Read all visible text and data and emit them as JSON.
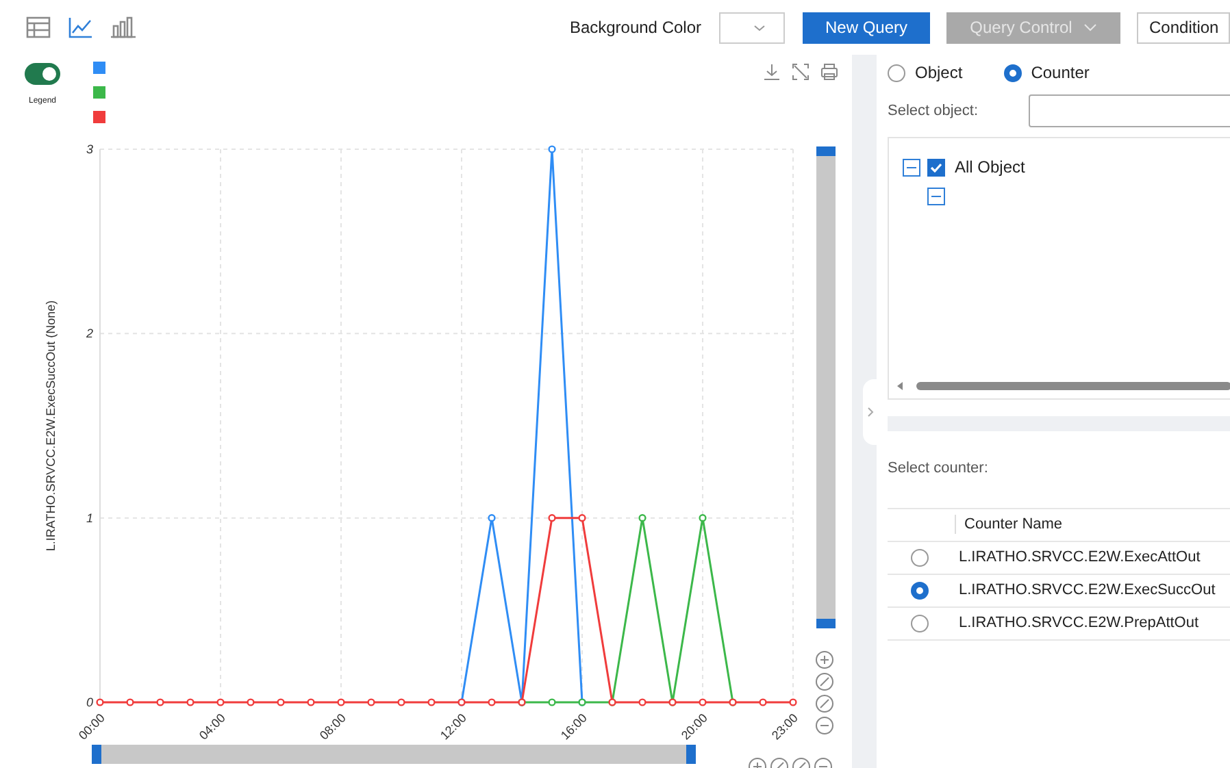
{
  "toolbar": {
    "views": [
      {
        "kind": "table",
        "selected": false
      },
      {
        "kind": "line",
        "selected": true
      },
      {
        "kind": "bar",
        "selected": false
      }
    ],
    "background_color_label": "Background Color",
    "buttons": [
      {
        "kind": "primary",
        "label": "New Query",
        "disabled": false
      },
      {
        "kind": "dropdown",
        "label": "Query Control",
        "disabled": true
      },
      {
        "kind": "outline",
        "label": "Condition",
        "disabled": false
      }
    ]
  },
  "chart": {
    "legend_toggle": {
      "label": "Legend",
      "on": true
    },
    "legend": [
      {
        "color": "#2f8df5"
      },
      {
        "color": "#3cb84a"
      },
      {
        "color": "#f03c3c"
      }
    ],
    "chart_data": {
      "type": "line",
      "ylabel": "L.IRATHO.SRVCC.E2W.ExecSuccOut (None)",
      "x": [
        0,
        1,
        2,
        3,
        4,
        5,
        6,
        7,
        8,
        9,
        10,
        11,
        12,
        13,
        14,
        15,
        16,
        17,
        18,
        19,
        20,
        21,
        22,
        23
      ],
      "series": [
        {
          "color": "#2f8df5",
          "marker": "circle",
          "values": [
            null,
            null,
            null,
            null,
            null,
            null,
            null,
            null,
            null,
            null,
            null,
            null,
            0,
            1,
            0,
            3,
            0,
            null,
            null,
            null,
            null,
            null,
            null,
            null
          ]
        },
        {
          "color": "#3cb84a",
          "marker": "circle",
          "values": [
            null,
            null,
            null,
            null,
            null,
            null,
            null,
            null,
            null,
            null,
            null,
            null,
            null,
            null,
            0,
            0,
            0,
            0,
            1,
            0,
            1,
            0,
            null,
            null
          ]
        },
        {
          "color": "#f03c3c",
          "marker": "circle",
          "values": [
            0,
            0,
            0,
            0,
            0,
            0,
            0,
            0,
            0,
            0,
            0,
            0,
            0,
            0,
            0,
            1,
            1,
            0,
            0,
            0,
            0,
            0,
            0,
            0
          ]
        }
      ],
      "grid": true,
      "xlim": [
        0,
        23
      ],
      "ylim": [
        0,
        3
      ],
      "yticks": [
        0,
        1,
        2,
        3
      ],
      "xticks": [
        {
          "value": 0,
          "label": "00:00"
        },
        {
          "value": 4,
          "label": "04:00"
        },
        {
          "value": 8,
          "label": "08:00"
        },
        {
          "value": 12,
          "label": "12:00"
        },
        {
          "value": 16,
          "label": "16:00"
        },
        {
          "value": 20,
          "label": "20:00"
        },
        {
          "value": 23,
          "label": "23:00"
        }
      ]
    }
  },
  "panel": {
    "modes": [
      {
        "label": "Object",
        "selected": false
      },
      {
        "label": "Counter",
        "selected": true
      }
    ],
    "select_object_label": "Select object:",
    "tree": [
      {
        "label": "All Object",
        "expanded": true,
        "checked": true,
        "children": [
          {
            "expanded": true
          }
        ]
      }
    ],
    "select_counter_label": "Select counter:",
    "counter_table": {
      "columns": [
        "Counter Name"
      ],
      "rows": [
        {
          "name": "L.IRATHO.SRVCC.E2W.ExecAttOut",
          "selected": false
        },
        {
          "name": "L.IRATHO.SRVCC.E2W.ExecSuccOut",
          "selected": true
        },
        {
          "name": "L.IRATHO.SRVCC.E2W.PrepAttOut",
          "selected": false
        }
      ]
    }
  }
}
